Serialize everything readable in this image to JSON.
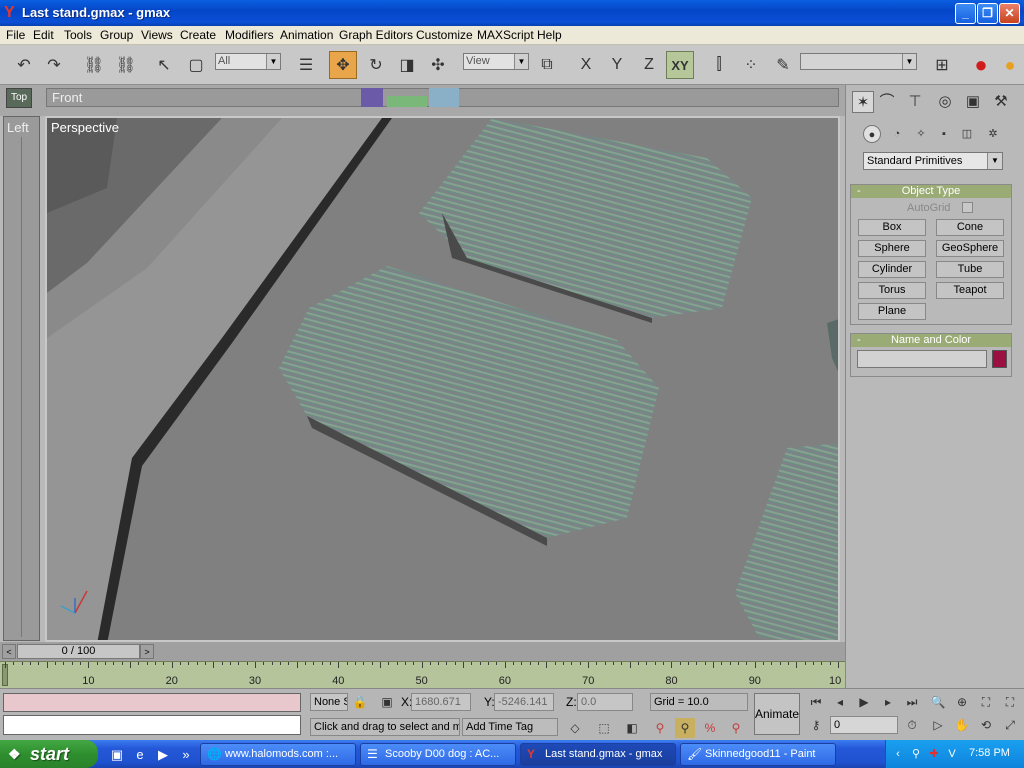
{
  "window": {
    "title": "Last stand.gmax - gmax",
    "app_icon": "gmax-icon",
    "controls": [
      "_",
      "❐",
      "✕"
    ]
  },
  "menu": [
    "File",
    "Edit",
    "Tools",
    "Group",
    "Views",
    "Create",
    "Modifiers",
    "Animation",
    "Graph Editors",
    "Customize",
    "MAXScript",
    "Help"
  ],
  "toolbar": {
    "selection_filter": "All",
    "ref_coord": "View",
    "axis_x": "X",
    "axis_y": "Y",
    "axis_z": "Z",
    "axis_xy": "XY",
    "named_selection": ""
  },
  "viewports": {
    "top_label": "Top",
    "front_label": "Front",
    "left_label": "Left",
    "perspective_label": "Perspective"
  },
  "command_panel": {
    "category": "Standard Primitives",
    "object_type_title": "Object Type",
    "autogrid_label": "AutoGrid",
    "buttons": [
      "Box",
      "Cone",
      "Sphere",
      "GeoSphere",
      "Cylinder",
      "Tube",
      "Torus",
      "Teapot",
      "Plane"
    ],
    "name_color_title": "Name and Color",
    "name_value": "",
    "object_color": "#9a1040"
  },
  "time": {
    "frame_display": "0 / 100",
    "ticks": [
      "10",
      "20",
      "30",
      "40",
      "50",
      "60",
      "70",
      "80",
      "90",
      "10"
    ]
  },
  "status": {
    "selection": "None S",
    "x_label": "X:",
    "x_value": "1680.671",
    "y_label": "Y:",
    "y_value": "-5246.141",
    "z_label": "Z:",
    "z_value": "0.0",
    "grid": "Grid = 10.0",
    "prompt": "Click and drag to select and m",
    "add_time_tag": "Add Time Tag",
    "animate": "Animate",
    "current_frame": "0"
  },
  "taskbar": {
    "start": "start",
    "tasks": [
      {
        "label": "www.halomods.com :...",
        "icon": "browser-icon",
        "active": false
      },
      {
        "label": "Scooby D00 dog : AC...",
        "icon": "forum-icon",
        "active": false
      },
      {
        "label": "Last stand.gmax - gmax",
        "icon": "gmax-icon",
        "active": true
      },
      {
        "label": "Skinnedgood11 - Paint",
        "icon": "paint-icon",
        "active": false
      }
    ],
    "clock": "7:58 PM"
  }
}
